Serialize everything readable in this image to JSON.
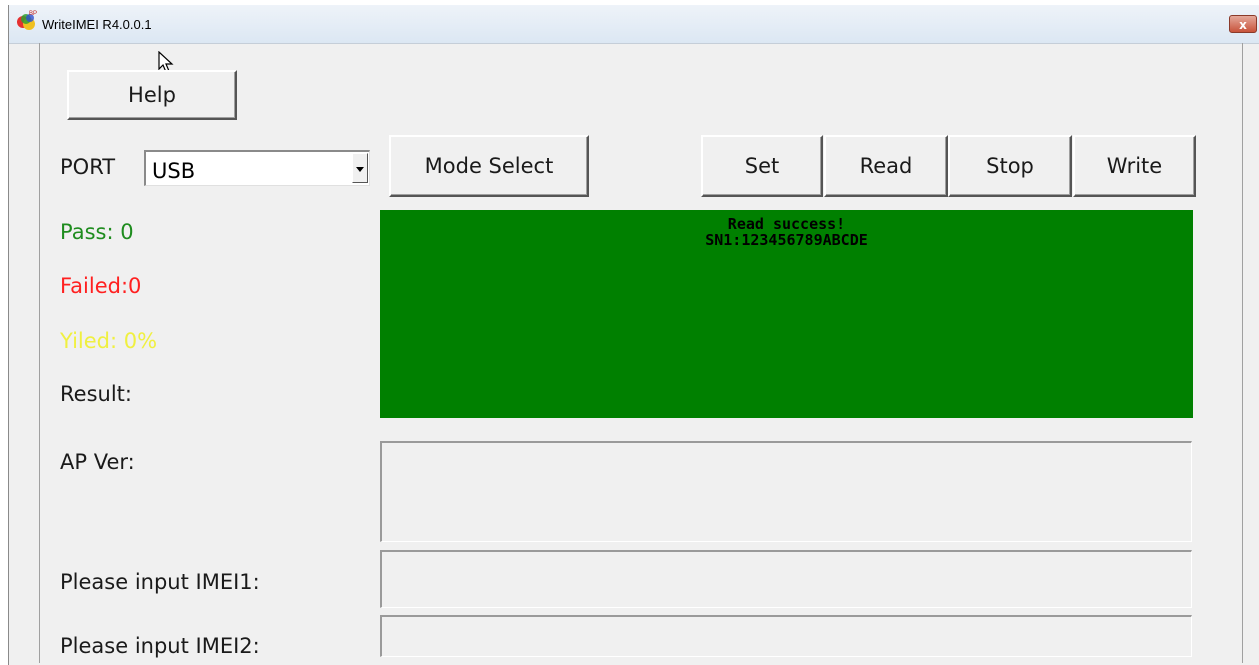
{
  "window": {
    "title": "WriteIMEI R4.0.0.1",
    "close_label": "x"
  },
  "toolbar": {
    "help_label": "Help",
    "mode_select_label": "Mode Select",
    "set_label": "Set",
    "read_label": "Read",
    "stop_label": "Stop",
    "write_label": "Write"
  },
  "port": {
    "label": "PORT",
    "selected": "USB"
  },
  "stats": {
    "pass": "Pass:  0",
    "failed": "Failed:0",
    "yield": "Yiled: 0%",
    "result_label": "Result:"
  },
  "result_panel": {
    "line1": "Read success!",
    "line2": "SN1:123456789ABCDE"
  },
  "fields": {
    "ap_ver_label": "AP Ver:",
    "imei1_label": "Please input IMEI1:",
    "imei2_label": "Please input IMEI2:",
    "imei1_value": "",
    "imei2_value": ""
  },
  "colors": {
    "pass": "#1e8c1e",
    "failed": "#ff2020",
    "yield": "#f0f040",
    "result_bg": "#008000"
  },
  "icons": {
    "app": "app-logo-icon",
    "cursor": "mouse-pointer-icon"
  }
}
